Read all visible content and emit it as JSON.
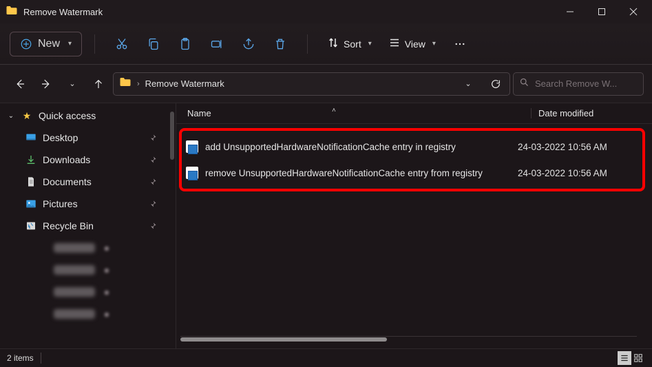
{
  "title": "Remove Watermark",
  "toolbar": {
    "new_label": "New",
    "sort_label": "Sort",
    "view_label": "View"
  },
  "breadcrumb": {
    "segment": "Remove Watermark"
  },
  "search": {
    "placeholder": "Search Remove W..."
  },
  "sidebar": {
    "quick_access": "Quick access",
    "items": [
      {
        "label": "Desktop"
      },
      {
        "label": "Downloads"
      },
      {
        "label": "Documents"
      },
      {
        "label": "Pictures"
      },
      {
        "label": "Recycle Bin"
      }
    ]
  },
  "columns": {
    "name": "Name",
    "date": "Date modified"
  },
  "files": [
    {
      "name": "add UnsupportedHardwareNotificationCache entry in registry",
      "date": "24-03-2022 10:56 AM"
    },
    {
      "name": "remove UnsupportedHardwareNotificationCache entry from registry",
      "date": "24-03-2022 10:56 AM"
    }
  ],
  "status": {
    "count": "2 items"
  }
}
